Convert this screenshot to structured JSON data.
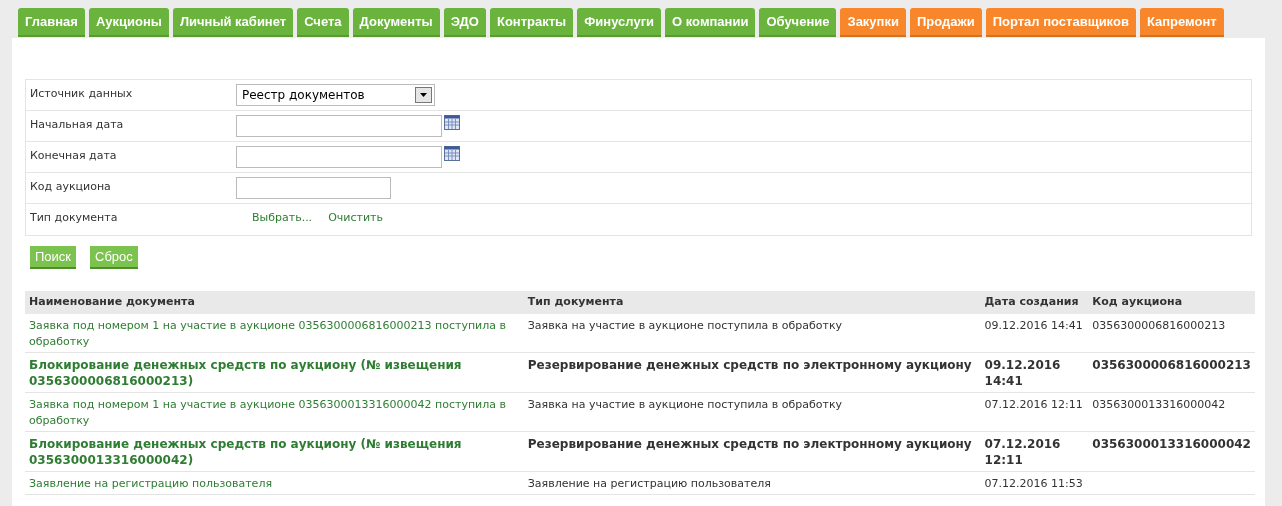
{
  "tabs": [
    {
      "label": "Главная",
      "color": "#6ab43e"
    },
    {
      "label": "Аукционы",
      "color": "#6ab43e"
    },
    {
      "label": "Личный кабинет",
      "color": "#6ab43e"
    },
    {
      "label": "Счета",
      "color": "#6ab43e"
    },
    {
      "label": "Документы",
      "color": "#6ab43e"
    },
    {
      "label": "ЭДО",
      "color": "#6ab43e"
    },
    {
      "label": "Контракты",
      "color": "#6ab43e"
    },
    {
      "label": "Финуслуги",
      "color": "#6ab43e"
    },
    {
      "label": "О компании",
      "color": "#6ab43e"
    },
    {
      "label": "Обучение",
      "color": "#6ab43e"
    },
    {
      "label": "Закупки",
      "color": "#f7872a"
    },
    {
      "label": "Продажи",
      "color": "#f7872a"
    },
    {
      "label": "Портал поставщиков",
      "color": "#f7872a"
    },
    {
      "label": "Капремонт",
      "color": "#f7872a"
    }
  ],
  "filters": [
    {
      "kind": "select",
      "label": "Источник данных",
      "value": "Реестр документов"
    },
    {
      "kind": "date",
      "label": "Начальная дата"
    },
    {
      "kind": "date",
      "label": "Конечная дата"
    },
    {
      "kind": "text",
      "label": "Код аукциона"
    },
    {
      "kind": "links",
      "label": "Тип документа",
      "links": [
        "Выбрать...",
        "Очистить"
      ]
    }
  ],
  "buttons": [
    "Поиск",
    "Сброс"
  ],
  "table": {
    "columns": [
      "Наименование документа",
      "Тип документа",
      "Дата создания",
      "Код аукциона"
    ],
    "rows": [
      {
        "bold": false,
        "cells": [
          "Заявка под номером 1 на участие в аукционе 0356300006816000213 поступила в обработку",
          "Заявка на участие в аукционе поступила в обработку",
          "09.12.2016 14:41",
          "0356300006816000213"
        ]
      },
      {
        "bold": true,
        "cells": [
          "Блокирование денежных средств по аукциону (№ извещения 0356300006816000213)",
          "Резервирование денежных средств по электронному аукциону",
          "09.12.2016 14:41",
          "0356300006816000213"
        ]
      },
      {
        "bold": false,
        "cells": [
          "Заявка под номером 1 на участие в аукционе 0356300013316000042 поступила в обработку",
          "Заявка на участие в аукционе поступила в обработку",
          "07.12.2016 12:11",
          "0356300013316000042"
        ]
      },
      {
        "bold": true,
        "cells": [
          "Блокирование денежных средств по аукциону (№ извещения 0356300013316000042)",
          "Резервирование денежных средств по электронному аукциону",
          "07.12.2016 12:11",
          "0356300013316000042"
        ]
      },
      {
        "bold": false,
        "cells": [
          "Заявление на регистрацию пользователя",
          "Заявление на регистрацию пользователя",
          "07.12.2016 11:53",
          ""
        ]
      }
    ]
  }
}
